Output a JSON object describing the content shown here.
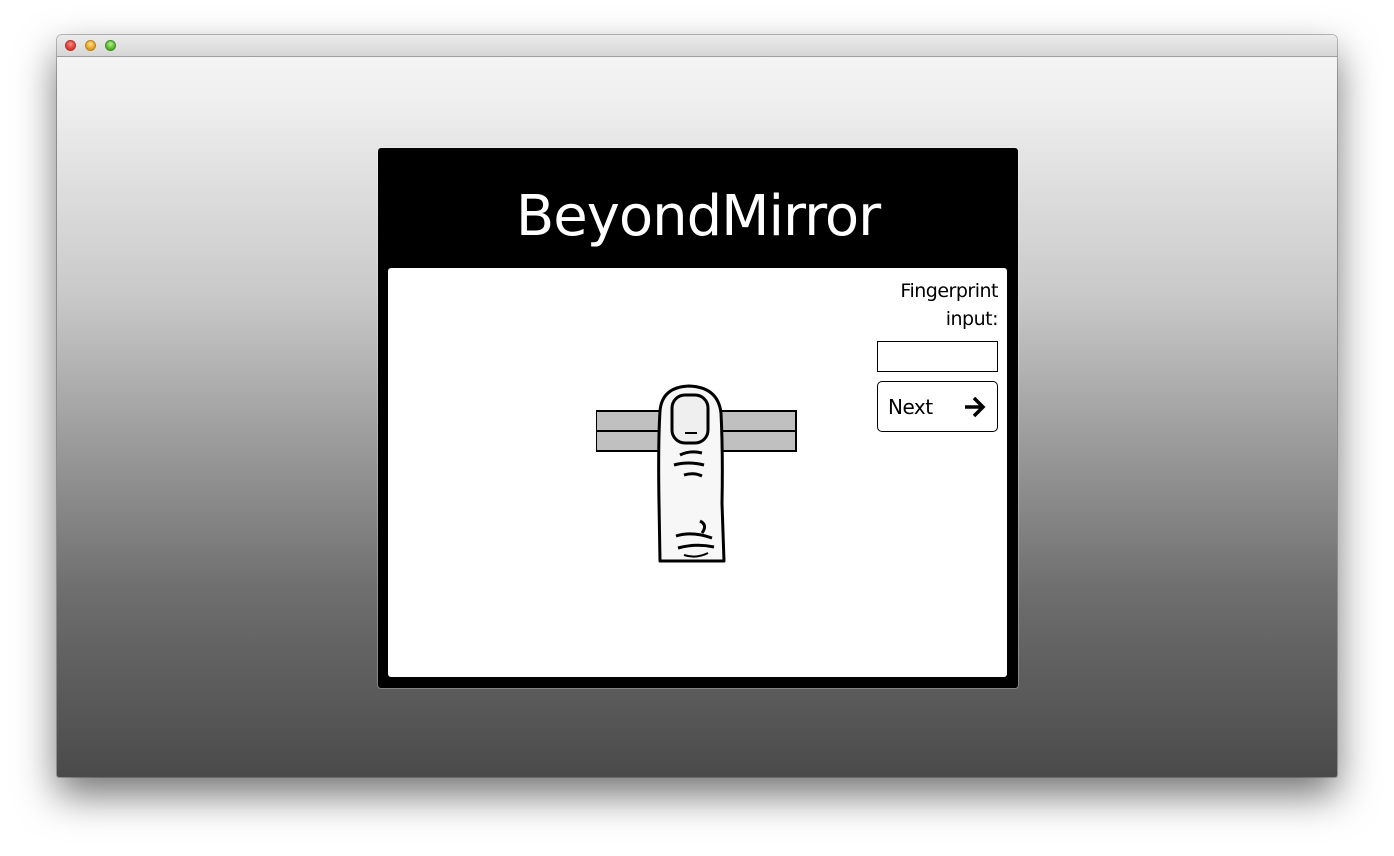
{
  "window": {
    "controls": [
      "close",
      "minimize",
      "zoom"
    ]
  },
  "app": {
    "title": "BeyondMirror",
    "fingerprint_label": "Fingerprint input:",
    "fingerprint_input_value": "",
    "next_label": "Next",
    "next_icon": "arrow-right-icon",
    "illustration_icon": "finger-on-scanner-illustration"
  },
  "colors": {
    "panel_background": "#000000",
    "content_background": "#ffffff",
    "scanner_fill": "#c0c0c0"
  }
}
